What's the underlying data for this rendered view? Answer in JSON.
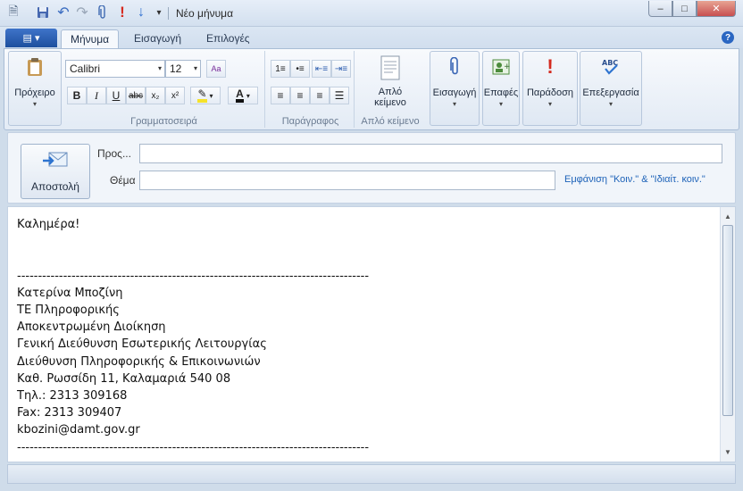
{
  "window": {
    "title": "Νέο μήνυμα",
    "minimize": "–",
    "maximize": "□",
    "close": "✕"
  },
  "quick_access": [
    {
      "name": "document-icon",
      "glyph": "🗎"
    },
    {
      "name": "save-icon",
      "glyph": "💾"
    },
    {
      "name": "undo-icon",
      "glyph": "↶"
    },
    {
      "name": "redo-icon",
      "glyph": "↷"
    },
    {
      "name": "attach-icon",
      "glyph": "📎"
    },
    {
      "name": "high-priority-icon",
      "glyph": "!"
    },
    {
      "name": "low-priority-icon",
      "glyph": "↓"
    },
    {
      "name": "qat-dropdown-icon",
      "glyph": "▾"
    }
  ],
  "tabs": {
    "message": "Μήνυμα",
    "insert": "Εισαγωγή",
    "options": "Επιλογές"
  },
  "ribbon": {
    "clipboard_label": "Πρόχειρο",
    "font_group_label": "Γραμματοσειρά",
    "paragraph_group_label": "Παράγραφος",
    "plaintext_group_label": "Απλό κείμενο",
    "plaintext_line1": "Απλό",
    "plaintext_line2": "κείμενο",
    "insert_label": "Εισαγωγή",
    "contacts_label": "Επαφές",
    "delivery_label": "Παράδοση",
    "editing_label": "Επεξεργασία",
    "font_name": "Calibri",
    "font_size": "12"
  },
  "compose": {
    "send_label": "Αποστολή",
    "to_label": "Προς...",
    "subject_label": "Θέμα",
    "to_value": "",
    "subject_value": "",
    "cc_link": "Εμφάνιση \"Κοιν.\" & \"Ιδιαίτ. κοιν.\""
  },
  "message_body": "Καλημέρα!\n\n\n------------------------------------------------------------------------------------\nΚατερίνα Μποζίνη\nΤΕ Πληροφορικής\nΑποκεντρωμένη Διοίκηση\nΓενική Διεύθυνση Εσωτερικής Λειτουργίας\nΔιεύθυνση Πληροφορικής & Επικοινωνιών\nΚαθ. Ρωσσίδη 11, Καλαμαριά 540 08\nΤηλ.: 2313 309168\nFax: 2313 309407\nkbozini@damt.gov.gr\n------------------------------------------------------------------------------------"
}
